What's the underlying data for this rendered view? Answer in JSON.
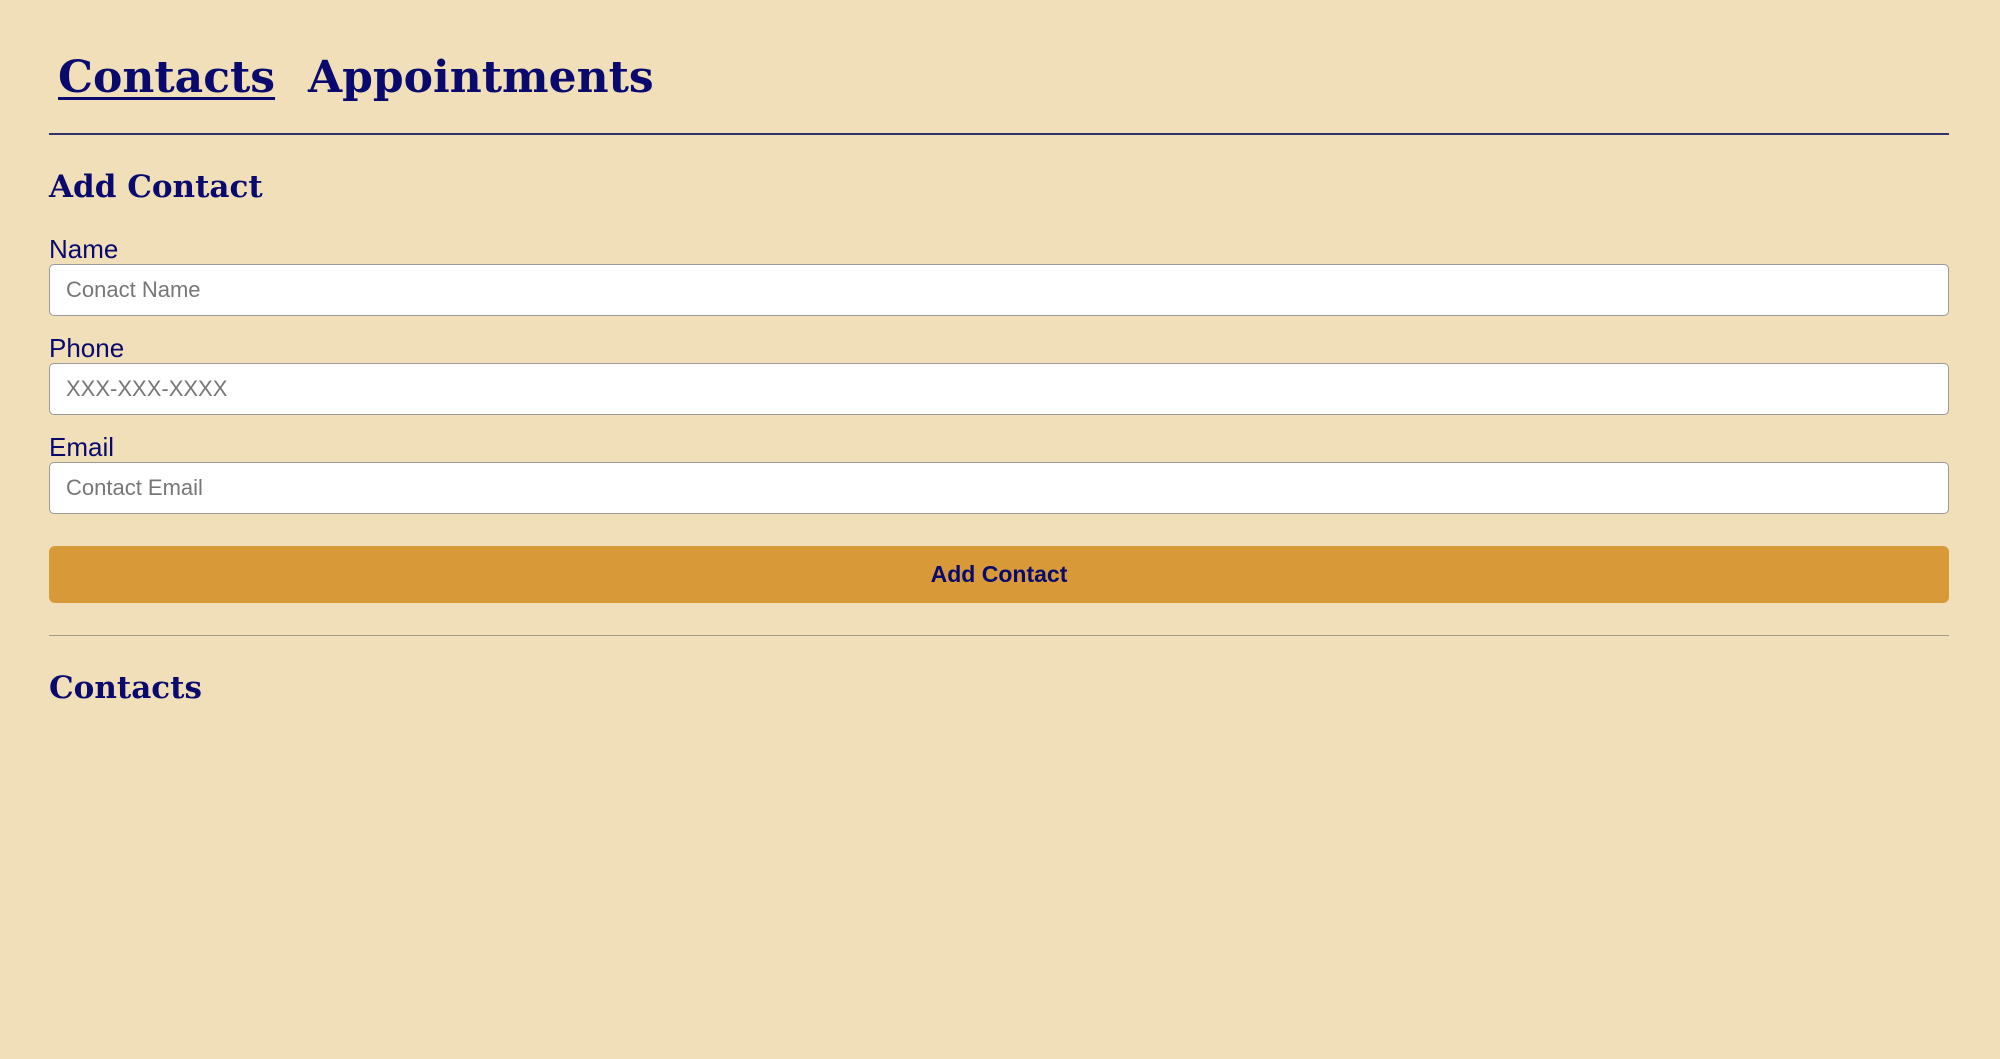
{
  "nav": {
    "tabs": [
      {
        "label": "Contacts",
        "active": true
      },
      {
        "label": "Appointments",
        "active": false
      }
    ]
  },
  "form": {
    "title": "Add Contact",
    "fields": [
      {
        "label": "Name",
        "placeholder": "Conact Name",
        "value": ""
      },
      {
        "label": "Phone",
        "placeholder": "XXX-XXX-XXXX",
        "value": ""
      },
      {
        "label": "Email",
        "placeholder": "Contact Email",
        "value": ""
      }
    ],
    "submit_label": "Add Contact"
  },
  "list": {
    "title": "Contacts",
    "items": []
  },
  "colors": {
    "background": "#f0dfb9",
    "text": "#0a0a6e",
    "button": "#d89a38",
    "input_background": "#ffffff"
  }
}
